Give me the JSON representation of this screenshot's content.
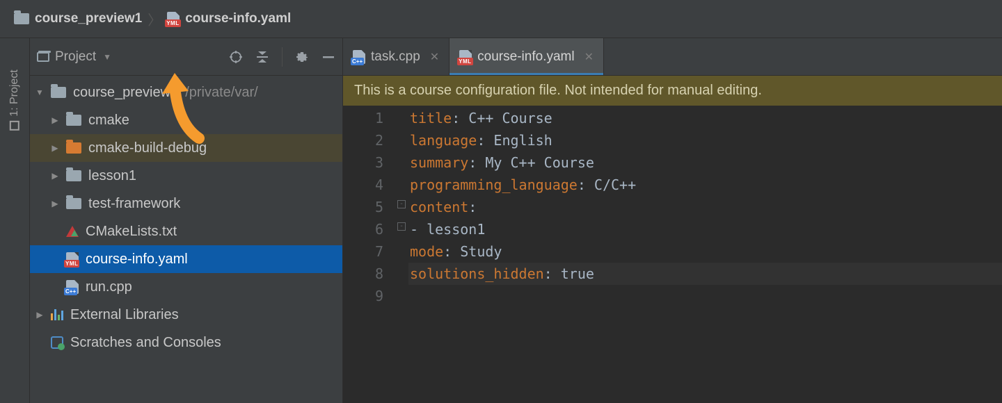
{
  "breadcrumb": {
    "root": "course_preview1",
    "file": "course-info.yaml",
    "yml_badge": "YML"
  },
  "left_rail": {
    "label": "1: Project"
  },
  "sidebar": {
    "view_label": "Project",
    "root": {
      "name": "course_preview1",
      "path": "/private/var/"
    },
    "items": [
      {
        "name": "cmake"
      },
      {
        "name": "cmake-build-debug"
      },
      {
        "name": "lesson1"
      },
      {
        "name": "test-framework"
      },
      {
        "name": "CMakeLists.txt"
      },
      {
        "name": "course-info.yaml"
      },
      {
        "name": "run.cpp"
      }
    ],
    "external_libs": "External Libraries",
    "scratches": "Scratches and Consoles"
  },
  "tabs": [
    {
      "label": "task.cpp",
      "badge": "C++"
    },
    {
      "label": "course-info.yaml",
      "badge": "YML"
    }
  ],
  "banner": "This is a course configuration file. Not intended for manual editing.",
  "gutters": [
    "1",
    "2",
    "3",
    "4",
    "5",
    "6",
    "7",
    "8",
    "9"
  ],
  "code": {
    "l1k": "title",
    "l1v": ": C++ Course",
    "l2k": "language",
    "l2v": ": English",
    "l3k": "summary",
    "l3v": ": My C++ Course",
    "l4k": "programming_language",
    "l4v": ": C/C++",
    "l5k": "content",
    "l5v": ":",
    "l6": "- lesson1",
    "l7k": "mode",
    "l7v": ": Study",
    "l8k": "solutions_hidden",
    "l8v": ": true"
  }
}
